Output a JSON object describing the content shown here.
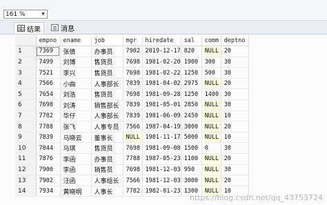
{
  "toolbar": {
    "zoom": "161 %"
  },
  "tabs": {
    "results": "结果",
    "messages": "消息"
  },
  "columns": [
    "empno",
    "ename",
    "job",
    "mgr",
    "hiredate",
    "sal",
    "comm",
    "deptno"
  ],
  "rows": [
    [
      "1",
      "7369",
      "张倩",
      "办事员",
      "7902",
      "2019-12-17",
      "820",
      "NULL",
      "20"
    ],
    [
      "2",
      "7499",
      "刘博",
      "售货员",
      "7698",
      "1981-02-20",
      "1900",
      "300",
      "30"
    ],
    [
      "3",
      "7521",
      "李兴",
      "售货员",
      "7698",
      "1981-02-22",
      "1250",
      "500",
      "30"
    ],
    [
      "4",
      "7566",
      "小曲",
      "人事部长",
      "7839",
      "1981-04-02",
      "2975",
      "NULL",
      "20"
    ],
    [
      "5",
      "7654",
      "刘浩",
      "售货员",
      "7698",
      "1981-09-28",
      "1250",
      "1400",
      "30"
    ],
    [
      "6",
      "7698",
      "刘涛",
      "销售部长",
      "7839",
      "1981-05-01",
      "2850",
      "NULL",
      "30"
    ],
    [
      "7",
      "7782",
      "华仔",
      "人事部长",
      "7839",
      "1981-06-09",
      "2450",
      "NULL",
      "10"
    ],
    [
      "8",
      "7788",
      "张飞",
      "人事专员",
      "7566",
      "1987-04-19",
      "3000",
      "NULL",
      "20"
    ],
    [
      "9",
      "7839",
      "马晓云",
      "董事长",
      "NULL",
      "1981-11-17",
      "5000",
      "NULL",
      "10"
    ],
    [
      "10",
      "7844",
      "马琪",
      "售货员",
      "7698",
      "1981-09-08",
      "1500",
      "0",
      "30"
    ],
    [
      "11",
      "7876",
      "李函",
      "办事员",
      "7788",
      "1987-05-23",
      "1100",
      "NULL",
      "20"
    ],
    [
      "12",
      "7900",
      "李函",
      "销售员",
      "7698",
      "1981-12-03",
      "950",
      "NULL",
      "30"
    ],
    [
      "13",
      "7902",
      "汪函",
      "人事组长",
      "7566",
      "1981-12-03",
      "3000",
      "NULL",
      "20"
    ],
    [
      "14",
      "7934",
      "黄晓明",
      "人事长",
      "7782",
      "1982-01-23",
      "1300",
      "NULL",
      "10"
    ]
  ],
  "watermark": "https://blog.csdn.net/qq_43753724"
}
